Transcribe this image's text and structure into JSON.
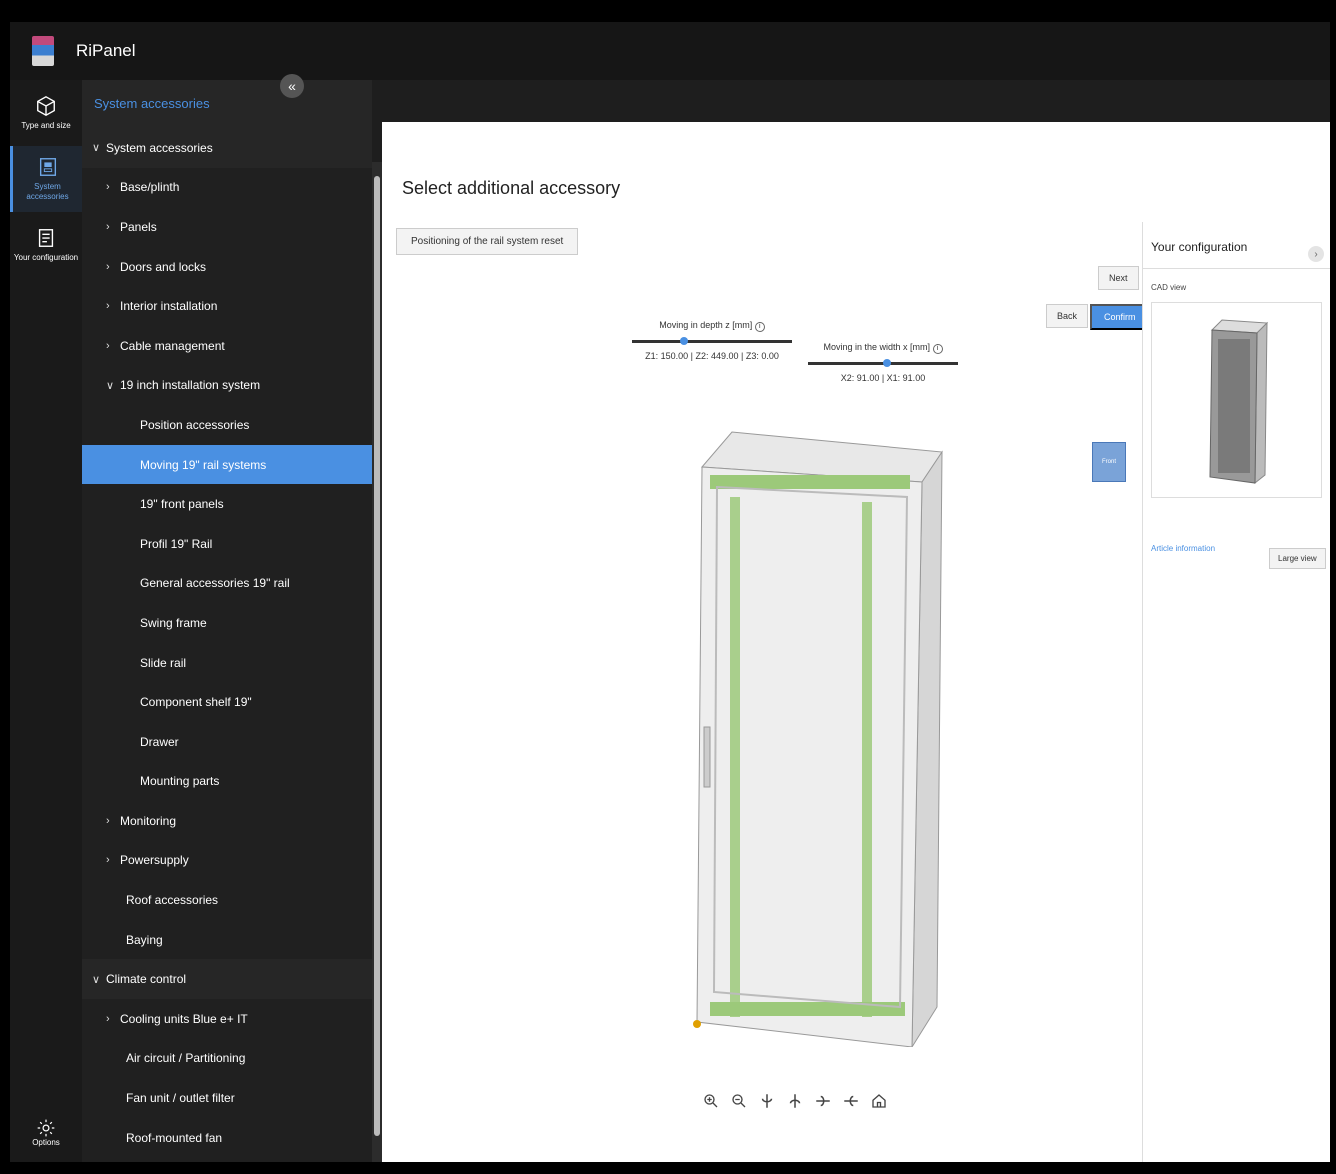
{
  "app": {
    "title": "RiPanel"
  },
  "rail": [
    {
      "label": "Type and size",
      "icon": "cube-icon"
    },
    {
      "label": "System accessories",
      "icon": "accessories-icon",
      "active": true
    },
    {
      "label": "Your configuration",
      "icon": "document-icon"
    }
  ],
  "rail_options": "Options",
  "tree": {
    "header": "System accessories",
    "rows": [
      {
        "label": "System accessories",
        "level": "l0",
        "chev": "open"
      },
      {
        "label": "Base/plinth",
        "level": "l1",
        "chev": "closed"
      },
      {
        "label": "Panels",
        "level": "l1",
        "chev": "closed"
      },
      {
        "label": "Doors and locks",
        "level": "l1",
        "chev": "closed"
      },
      {
        "label": "Interior installation",
        "level": "l1",
        "chev": "closed"
      },
      {
        "label": "Cable management",
        "level": "l1",
        "chev": "closed"
      },
      {
        "label": "19 inch installation system",
        "level": "l1",
        "chev": "open"
      },
      {
        "label": "Position accessories",
        "level": "l2",
        "chev": ""
      },
      {
        "label": "Moving 19\" rail systems",
        "level": "l2",
        "chev": "",
        "selected": true
      },
      {
        "label": "19\" front panels",
        "level": "l2",
        "chev": ""
      },
      {
        "label": "Profil 19\" Rail",
        "level": "l2",
        "chev": ""
      },
      {
        "label": "General accessories 19\" rail",
        "level": "l2",
        "chev": ""
      },
      {
        "label": "Swing frame",
        "level": "l2",
        "chev": ""
      },
      {
        "label": "Slide rail",
        "level": "l2",
        "chev": ""
      },
      {
        "label": "Component shelf 19\"",
        "level": "l2",
        "chev": ""
      },
      {
        "label": "Drawer",
        "level": "l2",
        "chev": ""
      },
      {
        "label": "Mounting parts",
        "level": "l2",
        "chev": ""
      },
      {
        "label": "Monitoring",
        "level": "l1",
        "chev": "closed"
      },
      {
        "label": "Powersupply",
        "level": "l1",
        "chev": "closed"
      },
      {
        "label": "Roof accessories",
        "level": "l1b",
        "chev": ""
      },
      {
        "label": "Baying",
        "level": "l1b",
        "chev": ""
      },
      {
        "label": "Climate control",
        "level": "l0",
        "chev": "open"
      },
      {
        "label": "Cooling units Blue e+ IT",
        "level": "l1",
        "chev": "closed"
      },
      {
        "label": "Air circuit / Partitioning",
        "level": "l1b",
        "chev": ""
      },
      {
        "label": "Fan unit / outlet filter",
        "level": "l1b",
        "chev": ""
      },
      {
        "label": "Roof-mounted fan",
        "level": "l1b",
        "chev": ""
      }
    ]
  },
  "main": {
    "title": "Select additional accessory",
    "reset_button": "Positioning of the rail system reset",
    "next_button": "Next",
    "back_button": "Back",
    "confirm_button": "Confirm",
    "slider_depth": {
      "label": "Moving in depth",
      "unit": "z [mm]",
      "value_text": "Z1: 150.00 | Z2: 449.00 | Z3: 0.00",
      "position": 0.3
    },
    "slider_width": {
      "label": "Moving in the width",
      "unit": "x [mm]",
      "value_text": "X2: 91.00 | X1: 91.00",
      "position": 0.5
    },
    "view_cube_label": "Front"
  },
  "config_panel": {
    "title": "Your configuration",
    "cad_label": "CAD view",
    "article_link": "Article information",
    "large_view_button": "Large view"
  },
  "colors": {
    "accent": "#4a90e2",
    "rail_green": "#8fc46b",
    "sidebar": "#1e1e1e"
  }
}
